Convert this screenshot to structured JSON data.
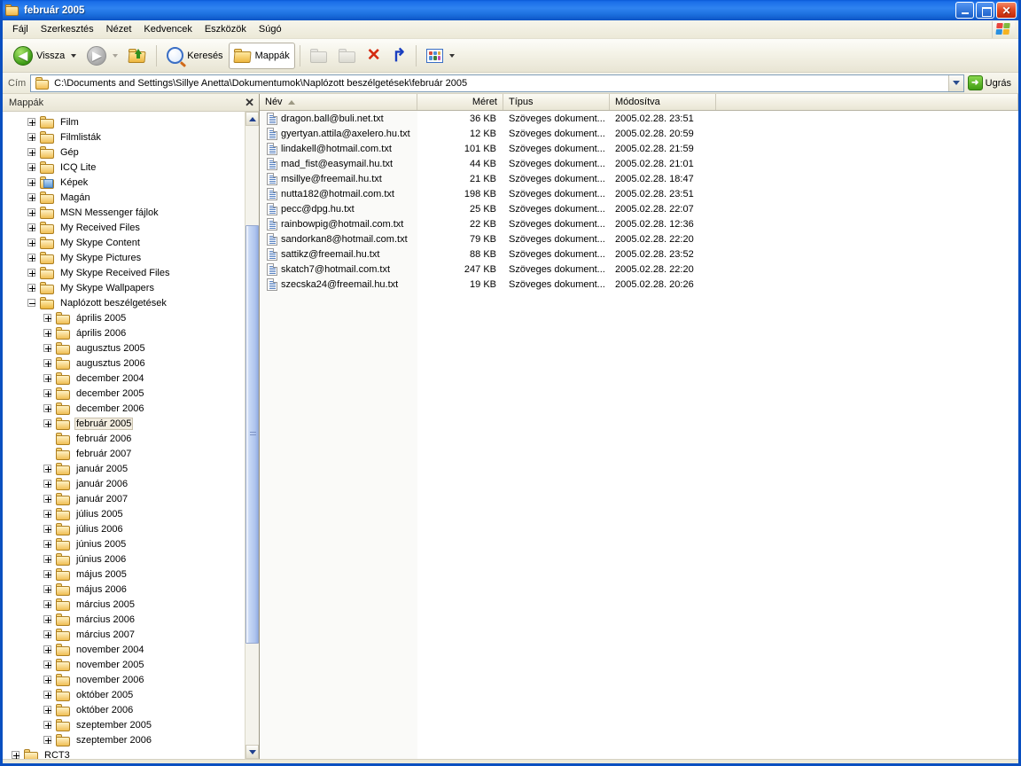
{
  "window": {
    "title": "február 2005",
    "icon": "folder-icon",
    "controls": {
      "minimize": "_",
      "maximize": "□",
      "close": "✕"
    }
  },
  "menu": {
    "items": [
      {
        "label": "Fájl",
        "name": "menu-file"
      },
      {
        "label": "Szerkesztés",
        "name": "menu-edit"
      },
      {
        "label": "Nézet",
        "name": "menu-view"
      },
      {
        "label": "Kedvencek",
        "name": "menu-favorites"
      },
      {
        "label": "Eszközök",
        "name": "menu-tools"
      },
      {
        "label": "Súgó",
        "name": "menu-help"
      }
    ]
  },
  "toolbar": {
    "back_label": "Vissza",
    "search_label": "Keresés",
    "folders_label": "Mappák",
    "buttons": [
      "back",
      "forward",
      "up",
      "search",
      "folders",
      "move-to",
      "copy-to",
      "delete",
      "undo",
      "views"
    ]
  },
  "address": {
    "label": "Cím",
    "path": "C:\\Documents and Settings\\Sillye Anetta\\Dokumentumok\\Naplózott beszélgetések\\február 2005",
    "go_label": "Ugrás"
  },
  "tree": {
    "header": "Mappák",
    "close": "✕",
    "nodes": [
      {
        "label": "Film",
        "indent": 1,
        "expandable": true,
        "icon": "folder"
      },
      {
        "label": "Filmlisták",
        "indent": 1,
        "expandable": true,
        "icon": "folder"
      },
      {
        "label": "Gép",
        "indent": 1,
        "expandable": true,
        "icon": "folder"
      },
      {
        "label": "ICQ Lite",
        "indent": 1,
        "expandable": true,
        "icon": "folder"
      },
      {
        "label": "Képek",
        "indent": 1,
        "expandable": true,
        "icon": "pictures"
      },
      {
        "label": "Magán",
        "indent": 1,
        "expandable": true,
        "icon": "folder"
      },
      {
        "label": "MSN Messenger fájlok",
        "indent": 1,
        "expandable": true,
        "icon": "folder"
      },
      {
        "label": "My Received Files",
        "indent": 1,
        "expandable": true,
        "icon": "folder"
      },
      {
        "label": "My Skype Content",
        "indent": 1,
        "expandable": true,
        "icon": "folder"
      },
      {
        "label": "My Skype Pictures",
        "indent": 1,
        "expandable": true,
        "icon": "folder"
      },
      {
        "label": "My Skype Received Files",
        "indent": 1,
        "expandable": true,
        "icon": "folder"
      },
      {
        "label": "My Skype Wallpapers",
        "indent": 1,
        "expandable": true,
        "icon": "folder"
      },
      {
        "label": "Naplózott beszélgetések",
        "indent": 1,
        "expandable": true,
        "expanded": true,
        "icon": "folder"
      },
      {
        "label": "április 2005",
        "indent": 2,
        "expandable": true,
        "icon": "folder"
      },
      {
        "label": "április 2006",
        "indent": 2,
        "expandable": true,
        "icon": "folder"
      },
      {
        "label": "augusztus 2005",
        "indent": 2,
        "expandable": true,
        "icon": "folder"
      },
      {
        "label": "augusztus 2006",
        "indent": 2,
        "expandable": true,
        "icon": "folder"
      },
      {
        "label": "december 2004",
        "indent": 2,
        "expandable": true,
        "icon": "folder"
      },
      {
        "label": "december 2005",
        "indent": 2,
        "expandable": true,
        "icon": "folder"
      },
      {
        "label": "december 2006",
        "indent": 2,
        "expandable": true,
        "icon": "folder"
      },
      {
        "label": "február 2005",
        "indent": 2,
        "expandable": true,
        "icon": "folder",
        "selected": true
      },
      {
        "label": "február 2006",
        "indent": 2,
        "expandable": false,
        "icon": "folder"
      },
      {
        "label": "február 2007",
        "indent": 2,
        "expandable": false,
        "icon": "folder"
      },
      {
        "label": "január 2005",
        "indent": 2,
        "expandable": true,
        "icon": "folder"
      },
      {
        "label": "január 2006",
        "indent": 2,
        "expandable": true,
        "icon": "folder"
      },
      {
        "label": "január 2007",
        "indent": 2,
        "expandable": true,
        "icon": "folder"
      },
      {
        "label": "július 2005",
        "indent": 2,
        "expandable": true,
        "icon": "folder"
      },
      {
        "label": "július 2006",
        "indent": 2,
        "expandable": true,
        "icon": "folder"
      },
      {
        "label": "június 2005",
        "indent": 2,
        "expandable": true,
        "icon": "folder"
      },
      {
        "label": "június 2006",
        "indent": 2,
        "expandable": true,
        "icon": "folder"
      },
      {
        "label": "május 2005",
        "indent": 2,
        "expandable": true,
        "icon": "folder"
      },
      {
        "label": "május 2006",
        "indent": 2,
        "expandable": true,
        "icon": "folder"
      },
      {
        "label": "március 2005",
        "indent": 2,
        "expandable": true,
        "icon": "folder"
      },
      {
        "label": "március 2006",
        "indent": 2,
        "expandable": true,
        "icon": "folder"
      },
      {
        "label": "március 2007",
        "indent": 2,
        "expandable": true,
        "icon": "folder"
      },
      {
        "label": "november 2004",
        "indent": 2,
        "expandable": true,
        "icon": "folder"
      },
      {
        "label": "november 2005",
        "indent": 2,
        "expandable": true,
        "icon": "folder"
      },
      {
        "label": "november 2006",
        "indent": 2,
        "expandable": true,
        "icon": "folder"
      },
      {
        "label": "október 2005",
        "indent": 2,
        "expandable": true,
        "icon": "folder"
      },
      {
        "label": "október 2006",
        "indent": 2,
        "expandable": true,
        "icon": "folder"
      },
      {
        "label": "szeptember 2005",
        "indent": 2,
        "expandable": true,
        "icon": "folder"
      },
      {
        "label": "szeptember 2006",
        "indent": 2,
        "expandable": true,
        "icon": "folder"
      },
      {
        "label": "RCT3",
        "indent": 0,
        "expandable": true,
        "icon": "folder"
      }
    ]
  },
  "filelist": {
    "columns": [
      {
        "label": "Név",
        "key": "name",
        "sorted": true,
        "sort_dir": "asc"
      },
      {
        "label": "Méret",
        "key": "size"
      },
      {
        "label": "Típus",
        "key": "type"
      },
      {
        "label": "Módosítva",
        "key": "modified"
      }
    ],
    "rows": [
      {
        "name": "dragon.ball@buli.net.txt",
        "size": "36 KB",
        "type": "Szöveges dokument...",
        "modified": "2005.02.28. 23:51"
      },
      {
        "name": "gyertyan.attila@axelero.hu.txt",
        "size": "12 KB",
        "type": "Szöveges dokument...",
        "modified": "2005.02.28. 20:59"
      },
      {
        "name": "lindakell@hotmail.com.txt",
        "size": "101 KB",
        "type": "Szöveges dokument...",
        "modified": "2005.02.28. 21:59"
      },
      {
        "name": "mad_fist@easymail.hu.txt",
        "size": "44 KB",
        "type": "Szöveges dokument...",
        "modified": "2005.02.28. 21:01"
      },
      {
        "name": "msillye@freemail.hu.txt",
        "size": "21 KB",
        "type": "Szöveges dokument...",
        "modified": "2005.02.28. 18:47"
      },
      {
        "name": "nutta182@hotmail.com.txt",
        "size": "198 KB",
        "type": "Szöveges dokument...",
        "modified": "2005.02.28. 23:51"
      },
      {
        "name": "pecc@dpg.hu.txt",
        "size": "25 KB",
        "type": "Szöveges dokument...",
        "modified": "2005.02.28. 22:07"
      },
      {
        "name": "rainbowpig@hotmail.com.txt",
        "size": "22 KB",
        "type": "Szöveges dokument...",
        "modified": "2005.02.28. 12:36"
      },
      {
        "name": "sandorkan8@hotmail.com.txt",
        "size": "79 KB",
        "type": "Szöveges dokument...",
        "modified": "2005.02.28. 22:20"
      },
      {
        "name": "sattikz@freemail.hu.txt",
        "size": "88 KB",
        "type": "Szöveges dokument...",
        "modified": "2005.02.28. 23:52"
      },
      {
        "name": "skatch7@hotmail.com.txt",
        "size": "247 KB",
        "type": "Szöveges dokument...",
        "modified": "2005.02.28. 22:20"
      },
      {
        "name": "szecska24@freemail.hu.txt",
        "size": "19 KB",
        "type": "Szöveges dokument...",
        "modified": "2005.02.28. 20:26"
      }
    ]
  },
  "colors": {
    "titlebar_blue": "#1a6ee8",
    "window_border": "#0a4fc0",
    "chrome_beige": "#ece9d8",
    "selection": "#f3ede0",
    "delete_red": "#d42a10",
    "go_green": "#3f9c12"
  }
}
